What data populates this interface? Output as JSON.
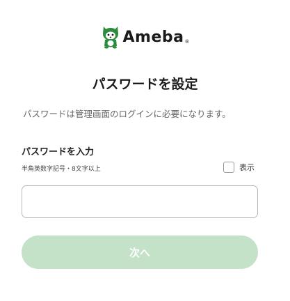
{
  "brand": {
    "name": "Ameba",
    "registered_mark": "®",
    "logo_icon": "ameba-mascot-icon",
    "brand_color": "#2d8c3c"
  },
  "page": {
    "title": "パスワードを設定",
    "description": "パスワードは管理画面のログインに必要になります。"
  },
  "password_field": {
    "label": "パスワードを入力",
    "hint": "半角英数字記号・8文字以上",
    "value": "",
    "placeholder": "",
    "show_label": "表示",
    "show_checked": false
  },
  "actions": {
    "next_label": "次へ",
    "next_disabled": true,
    "next_color": "#c4e2c8"
  }
}
